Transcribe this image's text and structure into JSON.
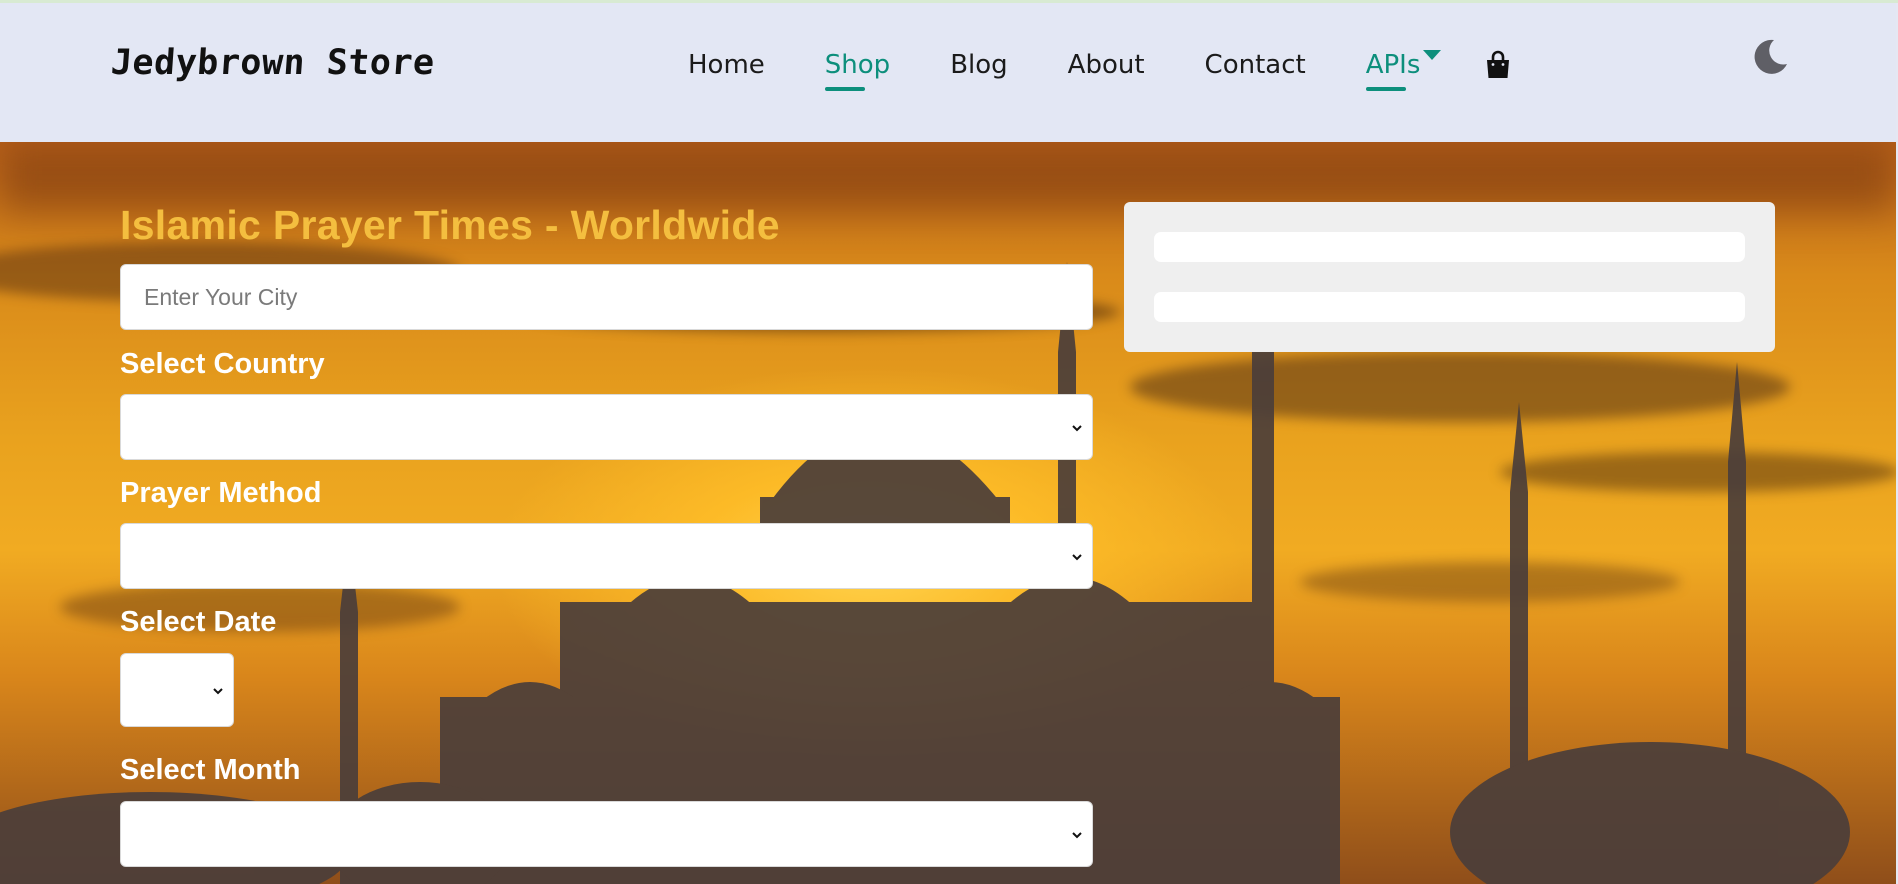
{
  "header": {
    "brand": "Jedybrown Store",
    "nav": [
      {
        "label": "Home",
        "active": false
      },
      {
        "label": "Shop",
        "active": true
      },
      {
        "label": "Blog",
        "active": false
      },
      {
        "label": "About",
        "active": false
      },
      {
        "label": "Contact",
        "active": false
      },
      {
        "label": "APIs",
        "active": true,
        "dropdown": true
      }
    ],
    "icons": {
      "cart": "shopping-bag-icon",
      "theme": "moon-icon"
    },
    "colors": {
      "accent": "#0d8f7c",
      "background": "#e3e7f4"
    }
  },
  "form": {
    "title": "Islamic Prayer Times - Worldwide",
    "city": {
      "placeholder": "Enter Your City",
      "value": ""
    },
    "country": {
      "label": "Select Country",
      "value": ""
    },
    "method": {
      "label": "Prayer Method",
      "value": ""
    },
    "date": {
      "label": "Select Date",
      "value": ""
    },
    "month": {
      "label": "Select Month",
      "value": ""
    },
    "colors": {
      "title": "#f4be3f",
      "label": "#ffffff"
    }
  },
  "result_card": {
    "bars": 2
  }
}
